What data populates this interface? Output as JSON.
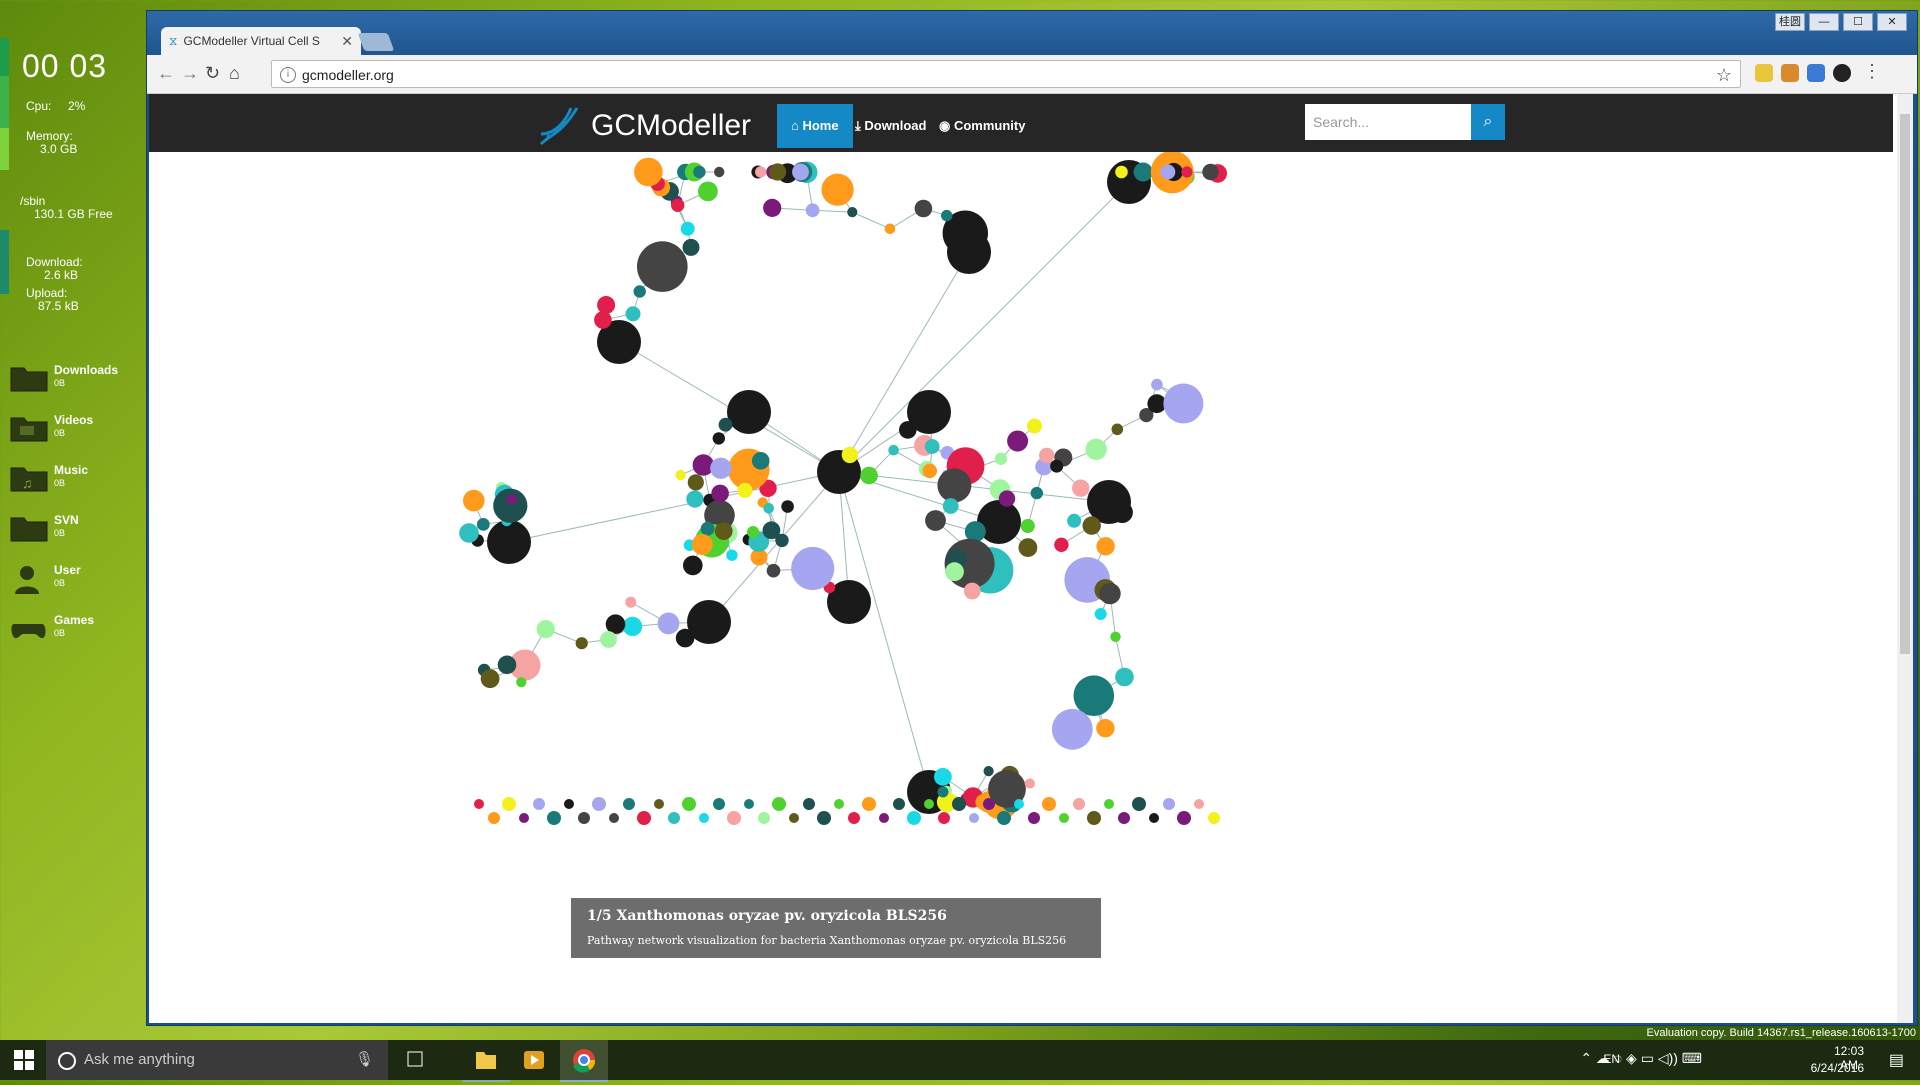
{
  "widgets": {
    "clock": "00 03",
    "cpu_label": "Cpu:",
    "cpu_value": "2%",
    "memory_label": "Memory:",
    "memory_value": "3.0 GB",
    "disk_label": "/sbin",
    "disk_value": "130.1 GB Free",
    "download_label": "Download:",
    "download_value": "2.6 kB",
    "upload_label": "Upload:",
    "upload_value": "87.5 kB",
    "folders": [
      {
        "label": "Downloads",
        "size": "0B",
        "icon": "folder-icon"
      },
      {
        "label": "Videos",
        "size": "0B",
        "icon": "video-folder-icon"
      },
      {
        "label": "Music",
        "size": "0B",
        "icon": "music-folder-icon"
      },
      {
        "label": "SVN",
        "size": "0B",
        "icon": "svn-folder-icon"
      },
      {
        "label": "User",
        "size": "0B",
        "icon": "user-icon"
      },
      {
        "label": "Games",
        "size": "0B",
        "icon": "gamepad-icon"
      }
    ]
  },
  "browser": {
    "tab_title": "GCModeller Virtual Cell S",
    "url": "gcmodeller.org",
    "window_controls": [
      "桂圆",
      "—",
      "☐",
      "✕"
    ]
  },
  "site": {
    "brand": "GCModeller",
    "nav": {
      "home": "Home",
      "download": "Download",
      "community": "Community"
    },
    "search_placeholder": "Search...",
    "caption_title": "1/5 Xanthomonas oryzae pv. oryzicola BLS256",
    "caption_sub": "Pathway network visualization for bacteria Xanthomonas oryzae pv. oryzicola BLS256"
  },
  "colors": {
    "accent": "#1589c6",
    "navbar": "#262626",
    "node_palette": [
      "#1a7a7a",
      "#444444",
      "#e0204a",
      "#19d9e6",
      "#f2f21a",
      "#f5a3a3",
      "#a6a6f0",
      "#7a1a7a",
      "#5f5a1a",
      "#1a1a1a",
      "#2fbfbf",
      "#ff9a1a",
      "#4fd12f",
      "#9ef59e",
      "#1f4f4f"
    ]
  },
  "taskbar": {
    "search_placeholder": "Ask me anything",
    "language": "EN",
    "time": "12:03 AM",
    "date": "6/24/2016",
    "eval_notice": "Evaluation copy. Build 14367.rs1_release.160613-1700"
  }
}
